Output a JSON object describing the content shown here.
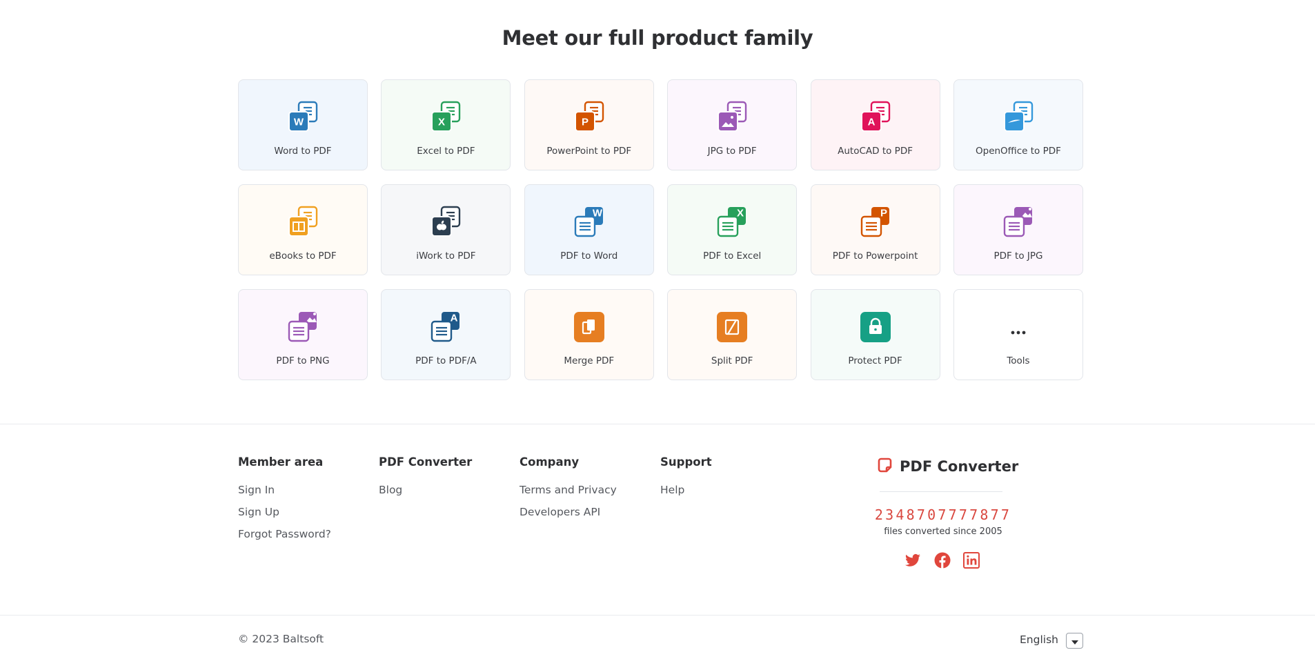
{
  "headline": "Meet our full product family",
  "products": [
    {
      "label": "Word to PDF",
      "icon": "word-to-pdf-icon",
      "bg": "#f0f6fd",
      "accent": "#2b7bb9",
      "glyph": "W",
      "kind": "to"
    },
    {
      "label": "Excel to PDF",
      "icon": "excel-to-pdf-icon",
      "bg": "#f5fbf6",
      "accent": "#27a05b",
      "glyph": "X",
      "kind": "to"
    },
    {
      "label": "PowerPoint to PDF",
      "icon": "powerpoint-to-pdf-icon",
      "bg": "#fef9f6",
      "accent": "#d35400",
      "glyph": "P",
      "kind": "to"
    },
    {
      "label": "JPG to PDF",
      "icon": "jpg-to-pdf-icon",
      "bg": "#fcf6fd",
      "accent": "#9b59b6",
      "glyph": "img",
      "kind": "to"
    },
    {
      "label": "AutoCAD to PDF",
      "icon": "autocad-to-pdf-icon",
      "bg": "#fef3f6",
      "accent": "#e0135a",
      "glyph": "A",
      "kind": "to"
    },
    {
      "label": "OpenOffice to PDF",
      "icon": "openoffice-to-pdf-icon",
      "bg": "#f5f9fd",
      "accent": "#3498db",
      "glyph": "oo",
      "kind": "to"
    },
    {
      "label": "eBooks to PDF",
      "icon": "ebooks-to-pdf-icon",
      "bg": "#fffbf5",
      "accent": "#f0a020",
      "glyph": "book",
      "kind": "to"
    },
    {
      "label": "iWork to PDF",
      "icon": "iwork-to-pdf-icon",
      "bg": "#f6f7f9",
      "accent": "#2c3e50",
      "glyph": "apple",
      "kind": "to"
    },
    {
      "label": "PDF to Word",
      "icon": "pdf-to-word-icon",
      "bg": "#f0f6fd",
      "accent": "#2b7bb9",
      "glyph": "W",
      "kind": "from"
    },
    {
      "label": "PDF to Excel",
      "icon": "pdf-to-excel-icon",
      "bg": "#f5fbf6",
      "accent": "#27a05b",
      "glyph": "X",
      "kind": "from"
    },
    {
      "label": "PDF to Powerpoint",
      "icon": "pdf-to-powerpoint-icon",
      "bg": "#fef9f6",
      "accent": "#d35400",
      "glyph": "P",
      "kind": "from"
    },
    {
      "label": "PDF to JPG",
      "icon": "pdf-to-jpg-icon",
      "bg": "#fcf6fd",
      "accent": "#9b59b6",
      "glyph": "img",
      "kind": "from"
    },
    {
      "label": "PDF to PNG",
      "icon": "pdf-to-png-icon",
      "bg": "#fcf6fd",
      "accent": "#9b59b6",
      "glyph": "img",
      "kind": "from"
    },
    {
      "label": "PDF to PDF/A",
      "icon": "pdf-to-pdfa-icon",
      "bg": "#f3f8fc",
      "accent": "#1f5a8a",
      "glyph": "A",
      "kind": "from"
    },
    {
      "label": "Merge PDF",
      "icon": "merge-pdf-icon",
      "bg": "#fffaf6",
      "accent": "#e67e22",
      "glyph": "merge",
      "kind": "tool"
    },
    {
      "label": "Split PDF",
      "icon": "split-pdf-icon",
      "bg": "#fffaf6",
      "accent": "#e67e22",
      "glyph": "split",
      "kind": "tool"
    },
    {
      "label": "Protect PDF",
      "icon": "protect-pdf-icon",
      "bg": "#f5fbf9",
      "accent": "#16a085",
      "glyph": "lock",
      "kind": "tool"
    },
    {
      "label": "Tools",
      "icon": "more-tools-icon",
      "bg": "#ffffff",
      "accent": "#2f3033",
      "glyph": "dots",
      "kind": "dots"
    }
  ],
  "footer": {
    "columns": [
      {
        "title": "Member area",
        "links": [
          "Sign In",
          "Sign Up",
          "Forgot Password?"
        ]
      },
      {
        "title": "PDF Converter",
        "links": [
          "Blog"
        ]
      },
      {
        "title": "Company",
        "links": [
          "Terms and Privacy",
          "Developers API"
        ]
      },
      {
        "title": "Support",
        "links": [
          "Help"
        ]
      }
    ],
    "brand_name": "PDF Converter",
    "counter": "2348707777877",
    "counter_caption": "files converted since 2005",
    "social": [
      "twitter-icon",
      "facebook-icon",
      "linkedin-icon"
    ],
    "accent": "#e0463c",
    "copyright": "© 2023 Baltsoft",
    "language": "English"
  }
}
